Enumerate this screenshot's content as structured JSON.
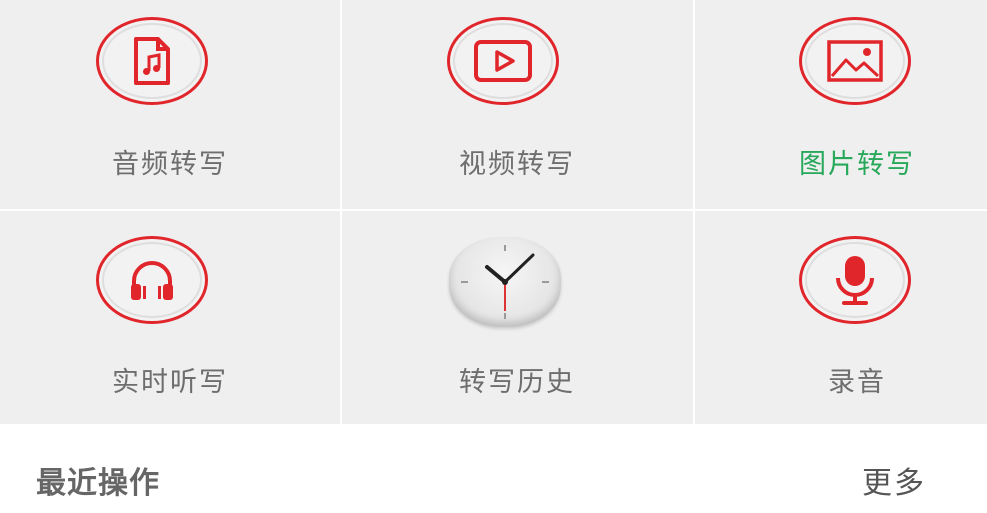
{
  "colors": {
    "accent": "#e0252b",
    "active_label": "#27a85a",
    "label": "#6e6e6e",
    "grid_bg": "#efefef"
  },
  "grid": {
    "items": [
      {
        "label": "音频转写",
        "icon": "audio-file-icon",
        "active": false
      },
      {
        "label": "视频转写",
        "icon": "video-play-icon",
        "active": false
      },
      {
        "label": "图片转写",
        "icon": "image-icon",
        "active": true
      },
      {
        "label": "实时听写",
        "icon": "headphones-icon",
        "active": false
      },
      {
        "label": "转写历史",
        "icon": "clock-icon",
        "active": false
      },
      {
        "label": "录音",
        "icon": "microphone-icon",
        "active": false
      }
    ]
  },
  "recent": {
    "title": "最近操作",
    "more_label": "更多"
  }
}
